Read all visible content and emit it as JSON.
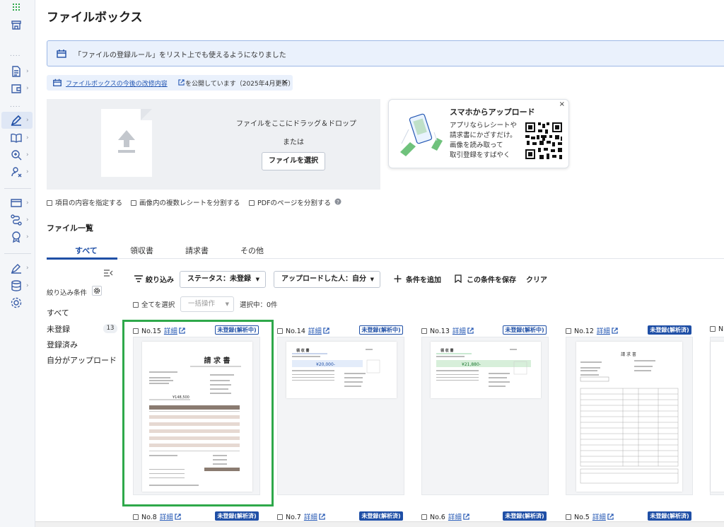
{
  "page": {
    "title": "ファイルボックス"
  },
  "banner": {
    "text": "「ファイルの登録ルール」をリスト上でも使えるようになりました"
  },
  "notice": {
    "link_text": "ファイルボックスの今後の改修内容",
    "rest_text": "を公開しています（2025年4月更新）",
    "close": "×"
  },
  "upload": {
    "drop_text": "ファイルをここにドラッグ＆ドロップ",
    "or_text": "または",
    "select_button": "ファイルを選択"
  },
  "mobile_card": {
    "title": "スマホからアップロード",
    "lines": [
      "アプリならレシートや",
      "請求書にかざすだけ。",
      "画像を読み取って",
      "取引登録をすばやく"
    ],
    "close": "×"
  },
  "options": [
    {
      "label": "項目の内容を指定する"
    },
    {
      "label": "画像内の複数レシートを分割する"
    },
    {
      "label": "PDFのページを分割する"
    }
  ],
  "list": {
    "title": "ファイル一覧",
    "tabs": [
      {
        "label": "すべて",
        "active": true
      },
      {
        "label": "領収書",
        "active": false
      },
      {
        "label": "請求書",
        "active": false
      },
      {
        "label": "その他",
        "active": false
      }
    ]
  },
  "filters": {
    "label": "絞り込み条件",
    "items": [
      {
        "label": "すべて"
      },
      {
        "label": "未登録",
        "count": "13"
      },
      {
        "label": "登録済み"
      },
      {
        "label": "自分がアップロード"
      }
    ]
  },
  "toolbar": {
    "filter": "絞り込み",
    "status": "ステータス：未登録",
    "uploader": "アップロードした人：自分",
    "add_condition": "条件を追加",
    "save_condition": "この条件を保存",
    "clear": "クリア"
  },
  "selection": {
    "select_all": "全てを選択",
    "bulk": "一括操作",
    "selected": "選択中：0件"
  },
  "cards_row1": [
    {
      "no": "No.15",
      "detail": "詳細",
      "badge": "未登録(解析中)",
      "filled": false
    },
    {
      "no": "No.14",
      "detail": "詳細",
      "badge": "未登録(解析中)",
      "filled": false
    },
    {
      "no": "No.13",
      "detail": "詳細",
      "badge": "未登録(解析中)",
      "filled": false
    },
    {
      "no": "No.12",
      "detail": "詳細",
      "badge": "未登録(解析済)",
      "filled": true
    },
    {
      "no": "N"
    }
  ],
  "cards_row2": [
    {
      "no": "No.8",
      "detail": "詳細",
      "badge": "未登録(解析済)"
    },
    {
      "no": "No.7",
      "detail": "詳細",
      "badge": "未登録(解析済)"
    },
    {
      "no": "No.6",
      "detail": "詳細",
      "badge": "未登録(解析済)"
    },
    {
      "no": "No.5",
      "detail": "詳細",
      "badge": "未登録(解析済)"
    }
  ],
  "thumbnails": {
    "t15": {
      "title": "請 求 書",
      "amount": "¥148,500"
    },
    "t14": {
      "title": "領 収 書",
      "amount": "¥20,000-"
    },
    "t13": {
      "title": "領 収 書",
      "amount": "¥21,880-"
    },
    "t12": {
      "title": "請 求 書"
    }
  },
  "colors": {
    "accent": "#1f4fa6",
    "highlight": "#2ea84a"
  }
}
